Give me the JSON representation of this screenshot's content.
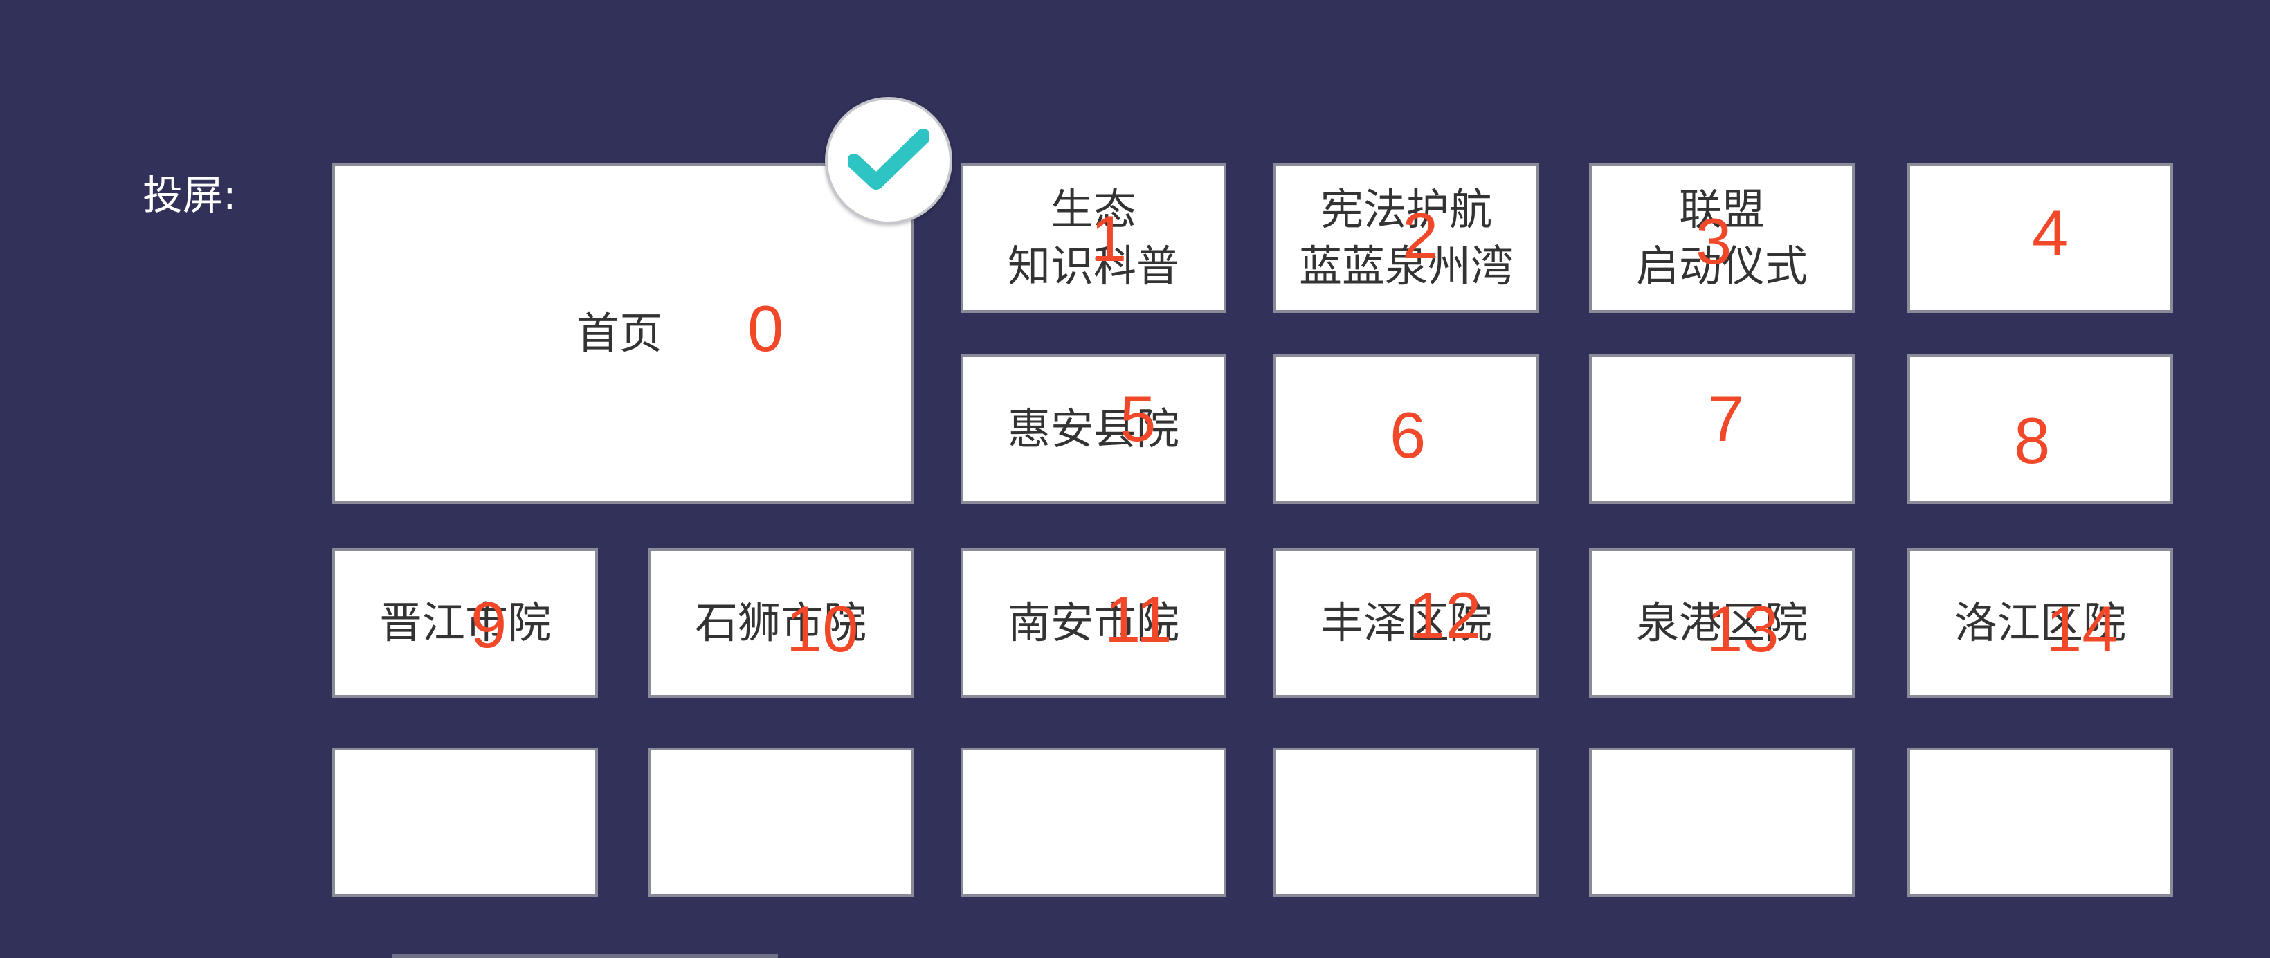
{
  "screen_label": "投屏:",
  "icons": {
    "selected": "check-icon",
    "accent_color": "#2ec4c4"
  },
  "tiles": [
    {
      "text": "首页",
      "number": "0",
      "selected": true
    },
    {
      "text": "生态\n知识科普",
      "number": "1"
    },
    {
      "text": "宪法护航\n蓝蓝泉州湾",
      "number": "2"
    },
    {
      "text": "联盟\n启动仪式",
      "number": "3"
    },
    {
      "text": "",
      "number": "4"
    },
    {
      "text": "惠安县院",
      "number": "5"
    },
    {
      "text": "",
      "number": "6"
    },
    {
      "text": "",
      "number": "7"
    },
    {
      "text": "",
      "number": "8"
    },
    {
      "text": "晋江市院",
      "number": "9"
    },
    {
      "text": "石狮市院",
      "number": "10"
    },
    {
      "text": "南安市院",
      "number": "11"
    },
    {
      "text": "丰泽区院",
      "number": "12"
    },
    {
      "text": "泉港区院",
      "number": "13"
    },
    {
      "text": "洛江区院",
      "number": "14"
    },
    {
      "text": "",
      "number": ""
    },
    {
      "text": "",
      "number": ""
    },
    {
      "text": "",
      "number": ""
    },
    {
      "text": "",
      "number": ""
    },
    {
      "text": "",
      "number": ""
    },
    {
      "text": "",
      "number": ""
    }
  ]
}
